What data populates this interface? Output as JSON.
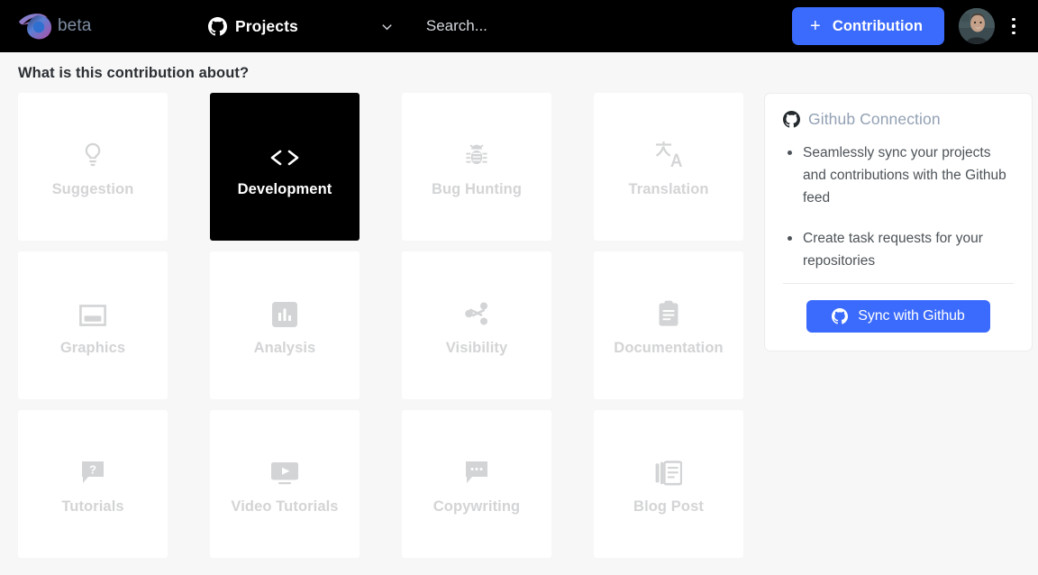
{
  "topbar": {
    "brand_beta": "beta",
    "brand_logo_icon": "eye-spiral-logo",
    "nav_project_icon": "github-mark-icon",
    "nav_project_label": "Projects",
    "chevron_icon": "chevron-down-icon",
    "search_placeholder": "Search...",
    "search_value": "",
    "contribution_plus": "+",
    "contribution_label": "Contribution",
    "avatar_icon": "user-avatar",
    "kebab_icon": "more-vertical-icon",
    "accent_color": "#3b6bfc",
    "bar_color": "#000000"
  },
  "main": {
    "title": "What is this contribution about?",
    "cards": [
      {
        "label": "Suggestion",
        "icon": "lightbulb-icon",
        "selected": false
      },
      {
        "label": "Development",
        "icon": "code-brackets-icon",
        "selected": true
      },
      {
        "label": "Bug Hunting",
        "icon": "bug-icon",
        "selected": false
      },
      {
        "label": "Translation",
        "icon": "translate-icon",
        "selected": false
      },
      {
        "label": "Graphics",
        "icon": "window-frame-icon",
        "selected": false
      },
      {
        "label": "Analysis",
        "icon": "bar-chart-icon",
        "selected": false
      },
      {
        "label": "Visibility",
        "icon": "share-icon",
        "selected": false
      },
      {
        "label": "Documentation",
        "icon": "clipboard-icon",
        "selected": false
      },
      {
        "label": "Tutorials",
        "icon": "question-bubble-icon",
        "selected": false
      },
      {
        "label": "Video Tutorials",
        "icon": "monitor-play-icon",
        "selected": false
      },
      {
        "label": "Copywriting",
        "icon": "ellipsis-bubble-icon",
        "selected": false
      },
      {
        "label": "Blog Post",
        "icon": "article-stack-icon",
        "selected": false
      }
    ]
  },
  "panel": {
    "icon": "github-mark-icon",
    "title": "Github Connection",
    "bullets": [
      "Seamlessly sync your projects and contributions with the Github feed",
      "Create task requests for your repositories"
    ],
    "sync_icon": "github-mark-icon",
    "sync_label": "Sync with Github"
  }
}
